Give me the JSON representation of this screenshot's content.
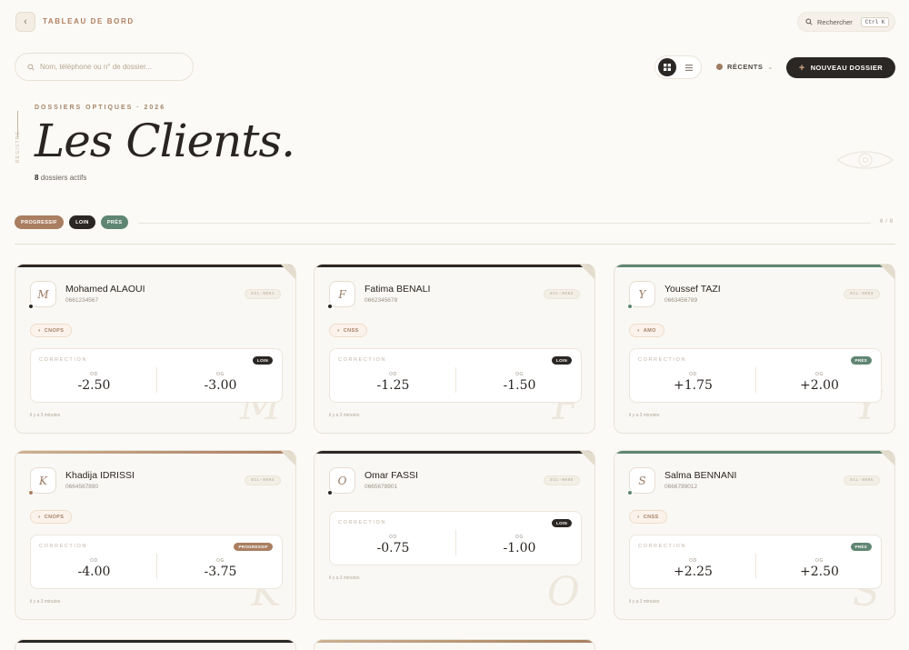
{
  "header": {
    "breadcrumb": "TABLEAU DE BORD",
    "search_label": "Rechercher",
    "search_shortcut": "Ctrl K"
  },
  "toolbar": {
    "search_placeholder": "Nom, téléphone ou n° de dossier...",
    "sort_label": "RÉCENTS",
    "new_button": "NOUVEAU DOSSIER"
  },
  "hero": {
    "eyebrow": "DOSSIERS OPTIQUES · 2026",
    "side_label": "REGISTRE",
    "title": "Les Clients.",
    "active_count": "8",
    "active_label": "dossiers actifs"
  },
  "legend": {
    "items": [
      "PROGRESSIF",
      "LOIN",
      "PRÈS"
    ],
    "count": "6 / 8"
  },
  "colors": {
    "progressif": "#a97e61",
    "loin": "#2a2724",
    "pres": "#5f8673"
  },
  "cards": [
    {
      "initial": "M",
      "name": "Mohamed ALAOUI",
      "phone": "0661234567",
      "id": "ECL-0001",
      "insurance": "CNOPS",
      "correction_label": "CORRECTION",
      "type": "LOIN",
      "color": "#2a2724",
      "od_label": "OD",
      "od": "-2.50",
      "og_label": "OG",
      "og": "-3.00",
      "ago": "il y a 3 minutes"
    },
    {
      "initial": "F",
      "name": "Fatima BENALI",
      "phone": "0662345678",
      "id": "ECL-0002",
      "insurance": "CNSS",
      "correction_label": "CORRECTION",
      "type": "LOIN",
      "color": "#2a2724",
      "od_label": "OD",
      "od": "-1.25",
      "og_label": "OG",
      "og": "-1.50",
      "ago": "il y a 3 minutes"
    },
    {
      "initial": "Y",
      "name": "Youssef TAZI",
      "phone": "0663456789",
      "id": "ECL-0003",
      "insurance": "AMO",
      "correction_label": "CORRECTION",
      "type": "PRÈS",
      "color": "#5f8673",
      "od_label": "OD",
      "od": "+1.75",
      "og_label": "OG",
      "og": "+2.00",
      "ago": "il y a 3 minutes"
    },
    {
      "initial": "K",
      "name": "Khadija IDRISSI",
      "phone": "0664567890",
      "id": "ECL-0004",
      "insurance": "CNOPS",
      "correction_label": "CORRECTION",
      "type": "PROGRESSIF",
      "color": "#a97e61",
      "od_label": "OD",
      "od": "-4.00",
      "og_label": "OG",
      "og": "-3.75",
      "ago": "il y a 3 minutes"
    },
    {
      "initial": "O",
      "name": "Omar FASSI",
      "phone": "0665678901",
      "id": "ECL-0005",
      "insurance": "",
      "correction_label": "CORRECTION",
      "type": "LOIN",
      "color": "#2a2724",
      "od_label": "OD",
      "od": "-0.75",
      "og_label": "OG",
      "og": "-1.00",
      "ago": "il y a 3 minutes"
    },
    {
      "initial": "S",
      "name": "Salma BENNANI",
      "phone": "0666789012",
      "id": "ECL-0006",
      "insurance": "CNSS",
      "correction_label": "CORRECTION",
      "type": "PRÈS",
      "color": "#5f8673",
      "od_label": "OD",
      "od": "+2.25",
      "og_label": "OG",
      "og": "+2.50",
      "ago": "il y a 3 minutes"
    }
  ]
}
